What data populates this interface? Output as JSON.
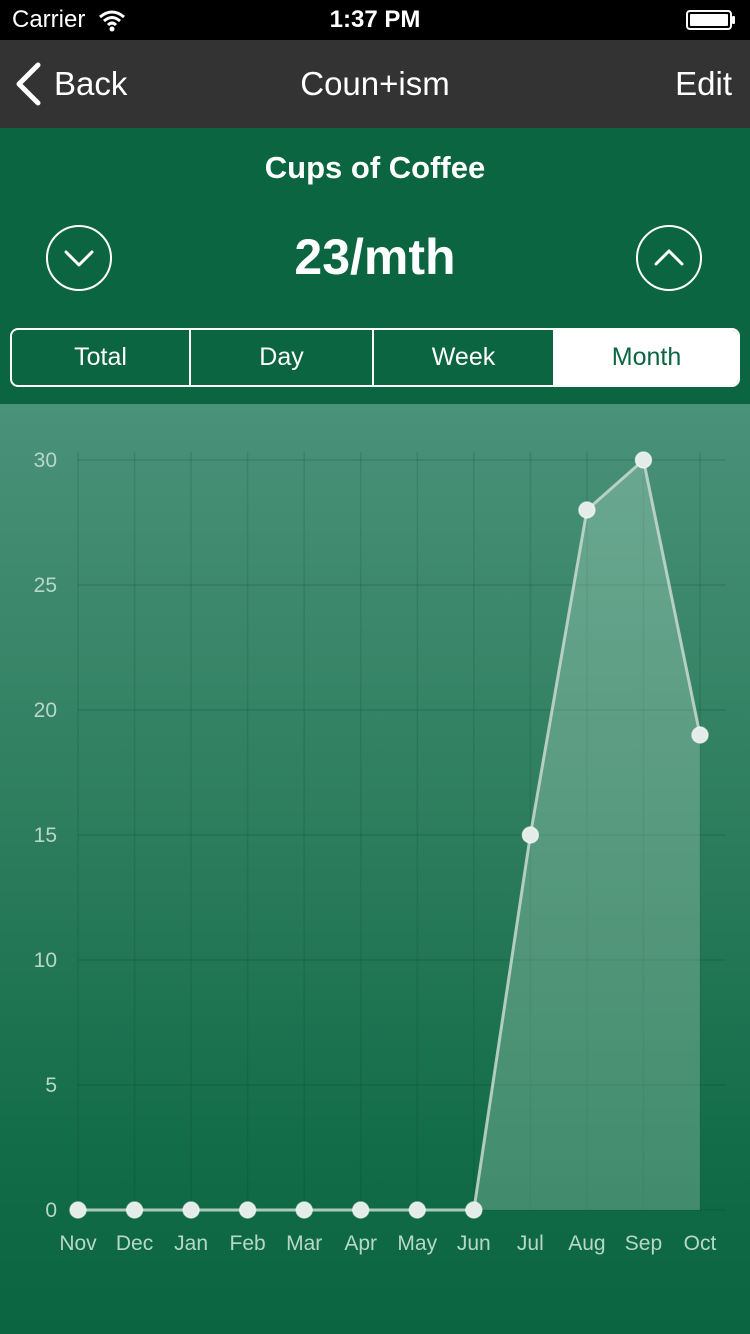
{
  "status_bar": {
    "carrier": "Carrier",
    "time": "1:37 PM",
    "icons": [
      "wifi-icon",
      "battery-icon"
    ]
  },
  "nav": {
    "back_label": "Back",
    "title": "Coun+ism",
    "edit_label": "Edit",
    "back_icon": "chevron-left-icon"
  },
  "counter": {
    "name": "Cups of Coffee",
    "rate": "23/mth",
    "decrement_icon": "chevron-down-icon",
    "increment_icon": "chevron-up-icon"
  },
  "segments": {
    "items": [
      "Total",
      "Day",
      "Week",
      "Month"
    ],
    "selected": "Month"
  },
  "colors": {
    "primary_green": "#0b6540",
    "nav_bar": "#333333",
    "line": "#c9d9d2",
    "point": "#e3ece8"
  },
  "chart_data": {
    "type": "area",
    "categories": [
      "Nov",
      "Dec",
      "Jan",
      "Feb",
      "Mar",
      "Apr",
      "May",
      "Jun",
      "Jul",
      "Aug",
      "Sep",
      "Oct"
    ],
    "values": [
      0,
      0,
      0,
      0,
      0,
      0,
      0,
      0,
      15,
      28,
      30,
      19
    ],
    "yticks": [
      0,
      5,
      10,
      15,
      20,
      25,
      30
    ],
    "ylim": [
      0,
      30
    ],
    "grid": true,
    "legend": "none"
  }
}
